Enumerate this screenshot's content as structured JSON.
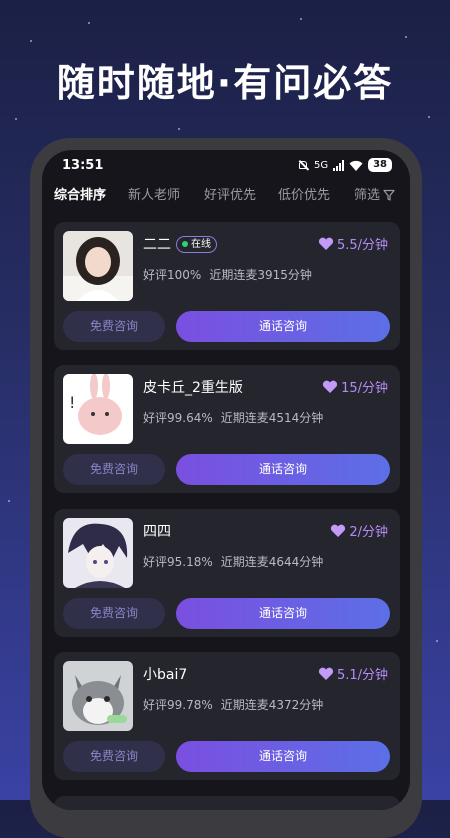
{
  "headline": "随时随地·有问必答",
  "status_bar": {
    "time": "13:51",
    "network": "5G",
    "battery": "38"
  },
  "tabs": [
    {
      "label": "综合排序",
      "active": true
    },
    {
      "label": "新人老师",
      "active": false
    },
    {
      "label": "好评优先",
      "active": false
    },
    {
      "label": "低价优先",
      "active": false
    },
    {
      "label": "筛选",
      "active": false
    }
  ],
  "online_label": "在线",
  "free_button": "免费咨询",
  "call_button": "通话咨询",
  "colors": {
    "accent": "#7a4fe0",
    "price": "#b48bf5",
    "online": "#2fd07a"
  },
  "consultants": [
    {
      "name": "二二",
      "online": true,
      "price": "5.5/分钟",
      "rating": "好评100%",
      "minutes": "近期连麦3915分钟"
    },
    {
      "name": "皮卡丘_2重生版",
      "online": false,
      "price": "15/分钟",
      "rating": "好评99.64%",
      "minutes": "近期连麦4514分钟"
    },
    {
      "name": "四四",
      "online": false,
      "price": "2/分钟",
      "rating": "好评95.18%",
      "minutes": "近期连麦4644分钟"
    },
    {
      "name": "小bai7",
      "online": false,
      "price": "5.1/分钟",
      "rating": "好评99.78%",
      "minutes": "近期连麦4372分钟"
    }
  ]
}
